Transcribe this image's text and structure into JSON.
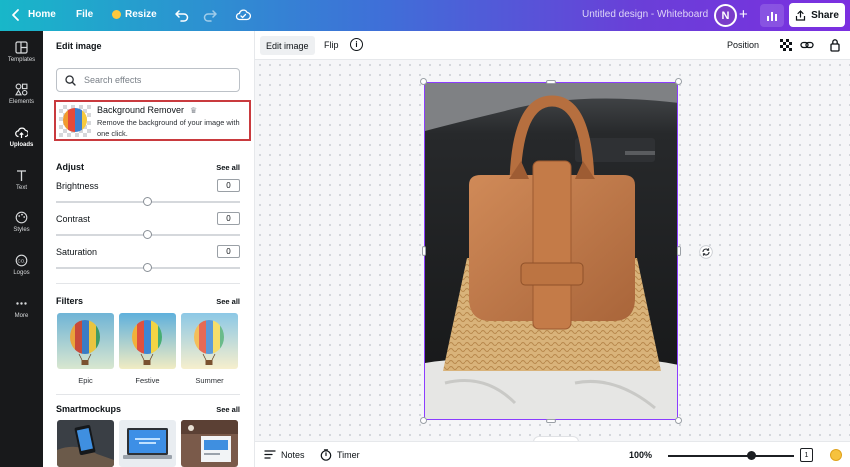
{
  "topbar": {
    "home_label": "Home",
    "file_label": "File",
    "resize_label": "Resize",
    "document_title": "Untitled design - Whiteboard",
    "avatar_initial": "N",
    "share_label": "Share"
  },
  "rail": {
    "items": [
      {
        "label": "Templates",
        "icon": "templates-icon"
      },
      {
        "label": "Elements",
        "icon": "elements-icon"
      },
      {
        "label": "Uploads",
        "icon": "uploads-icon"
      },
      {
        "label": "Text",
        "icon": "text-icon"
      },
      {
        "label": "Styles",
        "icon": "styles-icon"
      },
      {
        "label": "Logos",
        "icon": "logos-icon"
      },
      {
        "label": "More",
        "icon": "more-icon"
      }
    ],
    "active": "Uploads"
  },
  "panel": {
    "title": "Edit image",
    "search_placeholder": "Search effects",
    "bg_remover": {
      "title": "Background Remover",
      "description": "Remove the background of your image with one click."
    },
    "adjust": {
      "title": "Adjust",
      "see_all": "See all",
      "sliders": [
        {
          "label": "Brightness",
          "value": "0"
        },
        {
          "label": "Contrast",
          "value": "0"
        },
        {
          "label": "Saturation",
          "value": "0"
        }
      ]
    },
    "filters": {
      "title": "Filters",
      "see_all": "See all",
      "items": [
        {
          "label": "Epic"
        },
        {
          "label": "Festive"
        },
        {
          "label": "Summer"
        }
      ]
    },
    "smartmockups": {
      "title": "Smartmockups",
      "see_all": "See all"
    }
  },
  "canvas_toolbar": {
    "edit_image": "Edit image",
    "flip": "Flip",
    "info": "i",
    "position": "Position"
  },
  "bottom_bar": {
    "notes": "Notes",
    "timer": "Timer",
    "zoom": "100%",
    "zoom_level": 0.66,
    "page_number": "1"
  },
  "colors": {
    "selection": "#8b3dff",
    "highlight_border": "#c93a3e",
    "rail_bg": "#18191b"
  }
}
